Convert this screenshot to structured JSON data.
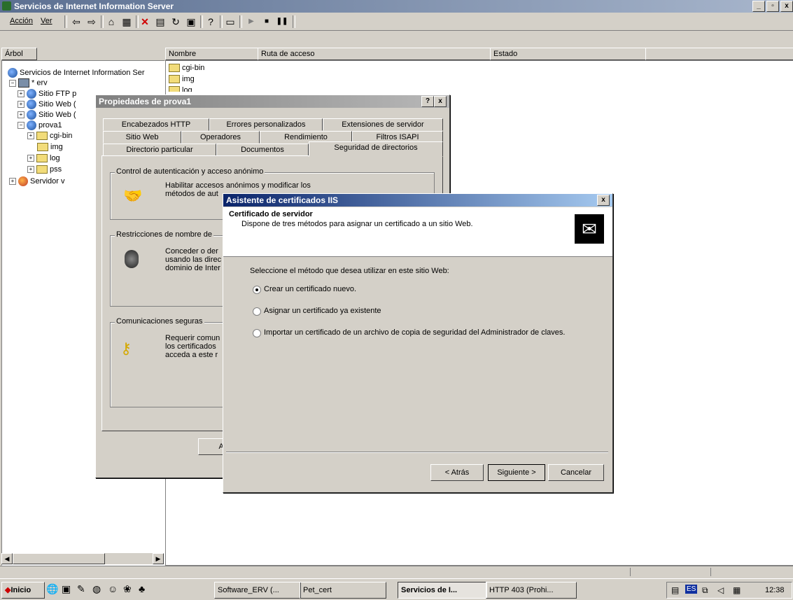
{
  "window": {
    "title": "Servicios de Internet Information Server",
    "buttons": [
      "_",
      "▫",
      "x"
    ]
  },
  "menu": {
    "accion": "Acción",
    "ver": "Ver"
  },
  "tree": {
    "header": "Árbol",
    "root": "Servicios de Internet Information Ser",
    "server": "* erv",
    "ftp": "Sitio FTP p",
    "web1": "Sitio Web (",
    "web2": "Sitio Web (",
    "prova1": "prova1",
    "cgibin": "cgi-bin",
    "img": "img",
    "log": "log",
    "pss": "pss",
    "servidor": "Servidor v"
  },
  "list": {
    "columns": [
      "Nombre",
      "Ruta de acceso",
      "Estado"
    ],
    "items": [
      "cgi-bin",
      "img",
      "log"
    ]
  },
  "props": {
    "title": "Propiedades de prova1",
    "tabs_row1": [
      "Encabezados HTTP",
      "Errores personalizados",
      "Extensiones de servidor"
    ],
    "tabs_row2": [
      "Sitio Web",
      "Operadores",
      "Rendimiento",
      "Filtros ISAPI"
    ],
    "tabs_row3": [
      "Directorio particular",
      "Documentos",
      "Seguridad de directorios"
    ],
    "group1_label": "Control de autenticación y acceso anónimo",
    "group1_text": "Habilitar accesos anónimos y modificar los\nmétodos de aut",
    "group2_label": "Restricciones de nombre de",
    "group2_text": "Conceder o der\nusando las direc\ndominio de Inter",
    "group3_label": "Comunicaciones seguras",
    "group3_text": "Requerir comun\nlos certificados\nacceda a este r",
    "ok": "Ace",
    "help": "?",
    "close": "x"
  },
  "wizard": {
    "title": "Asistente de certificados IIS",
    "close": "x",
    "header_title": "Certificado de servidor",
    "header_sub": "Dispone de tres métodos para asignar un certificado a un sitio Web.",
    "prompt": "Seleccione el método que desea utilizar en este sitio Web:",
    "options": [
      "Crear un certificado nuevo.",
      "Asignar un certificado ya existente",
      "Importar un certificado de un archivo de copia de seguridad del Administrador de claves."
    ],
    "selected": 0,
    "back": "< Atrás",
    "next": "Siguiente >",
    "cancel": "Cancelar"
  },
  "taskbar": {
    "start": "Inicio",
    "tasks": [
      "Software_ERV (...",
      "Pet_cert",
      "Servicios de I...",
      "HTTP 403 (Prohi..."
    ],
    "active": 2,
    "lang": "ES",
    "clock": "12:38"
  }
}
